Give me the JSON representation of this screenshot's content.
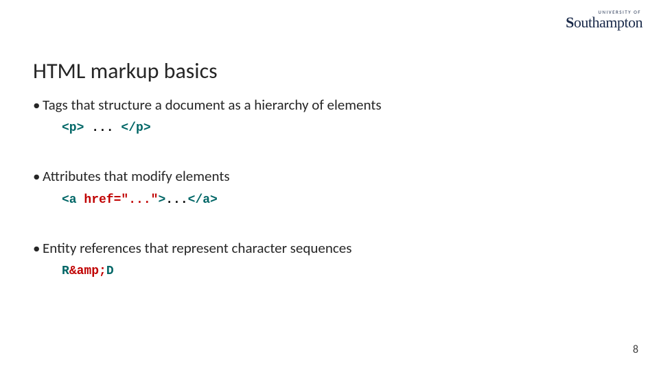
{
  "logo": {
    "top_line": "UNIVERSITY OF",
    "word_prefix": "S",
    "word_rest": "outhampton"
  },
  "title": "HTML markup basics",
  "bullets": [
    {
      "text": "Tags that structure a document as a hierarchy of elements",
      "code": {
        "open_tag": "<p>",
        "mid": " ... ",
        "close_tag": "</p>"
      }
    },
    {
      "text": "Attributes that modify elements",
      "code": {
        "open_tag": "<a ",
        "attr": "href=\"...\"",
        "after_attr": ">",
        "mid": "...",
        "close_tag": "</a>"
      }
    },
    {
      "text": "Entity references that represent character sequences",
      "code": {
        "r": "R",
        "amp": "&amp;",
        "d": "D"
      }
    }
  ],
  "page_number": "8"
}
